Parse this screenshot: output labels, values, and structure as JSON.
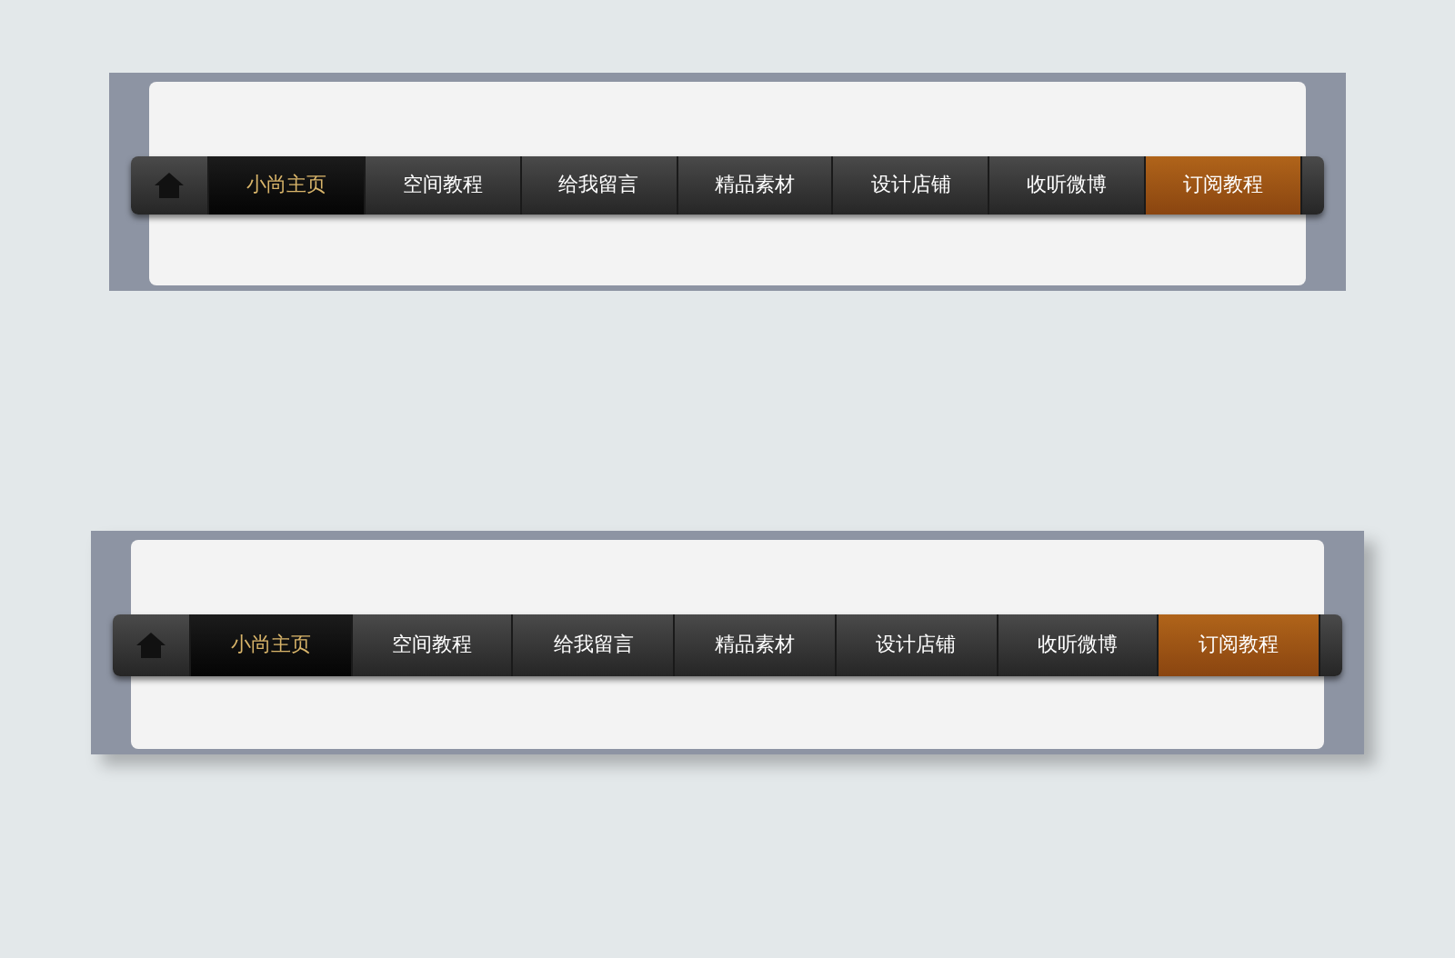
{
  "navbars": [
    {
      "items": [
        {
          "label": "小尚主页",
          "selected": true,
          "kind": "normal"
        },
        {
          "label": "空间教程",
          "selected": false,
          "kind": "normal"
        },
        {
          "label": "给我留言",
          "selected": false,
          "kind": "normal"
        },
        {
          "label": "精品素材",
          "selected": false,
          "kind": "normal"
        },
        {
          "label": "设计店铺",
          "selected": false,
          "kind": "normal"
        },
        {
          "label": "收听微博",
          "selected": false,
          "kind": "normal"
        },
        {
          "label": "订阅教程",
          "selected": false,
          "kind": "accent"
        }
      ]
    },
    {
      "items": [
        {
          "label": "小尚主页",
          "selected": true,
          "kind": "normal"
        },
        {
          "label": "空间教程",
          "selected": false,
          "kind": "normal"
        },
        {
          "label": "给我留言",
          "selected": false,
          "kind": "normal"
        },
        {
          "label": "精品素材",
          "selected": false,
          "kind": "normal"
        },
        {
          "label": "设计店铺",
          "selected": false,
          "kind": "normal"
        },
        {
          "label": "收听微博",
          "selected": false,
          "kind": "normal"
        },
        {
          "label": "订阅教程",
          "selected": false,
          "kind": "accent"
        }
      ]
    }
  ]
}
